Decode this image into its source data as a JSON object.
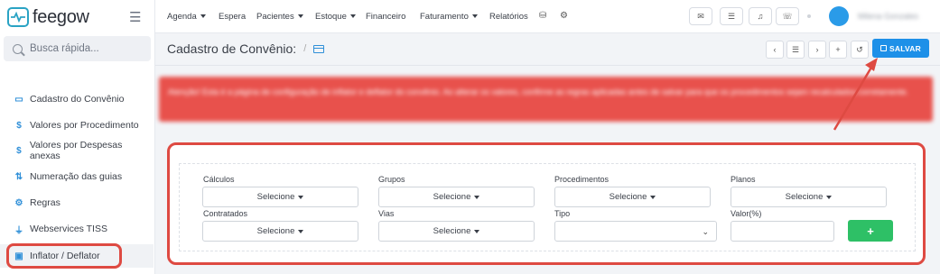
{
  "app": {
    "logo_text": "feegow"
  },
  "search": {
    "placeholder": "Busca rápida..."
  },
  "topnav": [
    {
      "label": "Agenda",
      "dropdown": true
    },
    {
      "label": "Espera",
      "dropdown": false
    },
    {
      "label": "Pacientes",
      "dropdown": true
    },
    {
      "label": "Estoque",
      "dropdown": true
    },
    {
      "label": "Financeiro",
      "dropdown": false
    },
    {
      "label": "Faturamento",
      "dropdown": true
    },
    {
      "label": "Relatórios",
      "dropdown": false
    }
  ],
  "topbar_icons": [
    "database-icon",
    "gear-icon",
    "inbox-icon",
    "list-icon",
    "bell-icon",
    "chat-icon"
  ],
  "user": {
    "name": "Milena Gonzales"
  },
  "sidebar": {
    "items": [
      {
        "label": "Cadastro do Convênio",
        "icon": "card-icon"
      },
      {
        "label": "Valores por Procedimento",
        "icon": "dollar-icon"
      },
      {
        "label": "Valores por Despesas anexas",
        "icon": "dollar-icon"
      },
      {
        "label": "Numeração das guias",
        "icon": "sort-icon"
      },
      {
        "label": "Regras",
        "icon": "cogs-icon"
      },
      {
        "label": "Webservices TISS",
        "icon": "plug-icon"
      },
      {
        "label": "Inflator / Deflator",
        "icon": "money-icon"
      }
    ],
    "active": "Inflator / Deflator"
  },
  "header": {
    "title": "Cadastro de Convênio:",
    "separator": "/",
    "save_label": "SALVAR",
    "buttons": [
      "chevron-left-icon",
      "list-icon",
      "chevron-right-icon",
      "plus-icon",
      "history-icon"
    ]
  },
  "alert": {
    "text": "Atenção! Esta é a página de configuração de inflator e deflator do convênio. Ao alterar os valores, confirme as regras aplicadas antes de salvar para que os procedimentos sejam recalculados corretamente."
  },
  "filters": {
    "row1": [
      {
        "label": "Cálculos",
        "value": "Selecione"
      },
      {
        "label": "Grupos",
        "value": "Selecione"
      },
      {
        "label": "Procedimentos",
        "value": "Selecione"
      },
      {
        "label": "Planos",
        "value": "Selecione"
      }
    ],
    "row2": [
      {
        "label": "Contratados",
        "value": "Selecione"
      },
      {
        "label": "Vias",
        "value": "Selecione"
      },
      {
        "label": "Tipo",
        "value": ""
      },
      {
        "label": "Valor(%)",
        "value": ""
      }
    ],
    "add_label": "+"
  },
  "colors": {
    "accent": "#1e90e8",
    "highlight": "#de4a42",
    "alert": "#e8514c",
    "add": "#2ec066"
  }
}
